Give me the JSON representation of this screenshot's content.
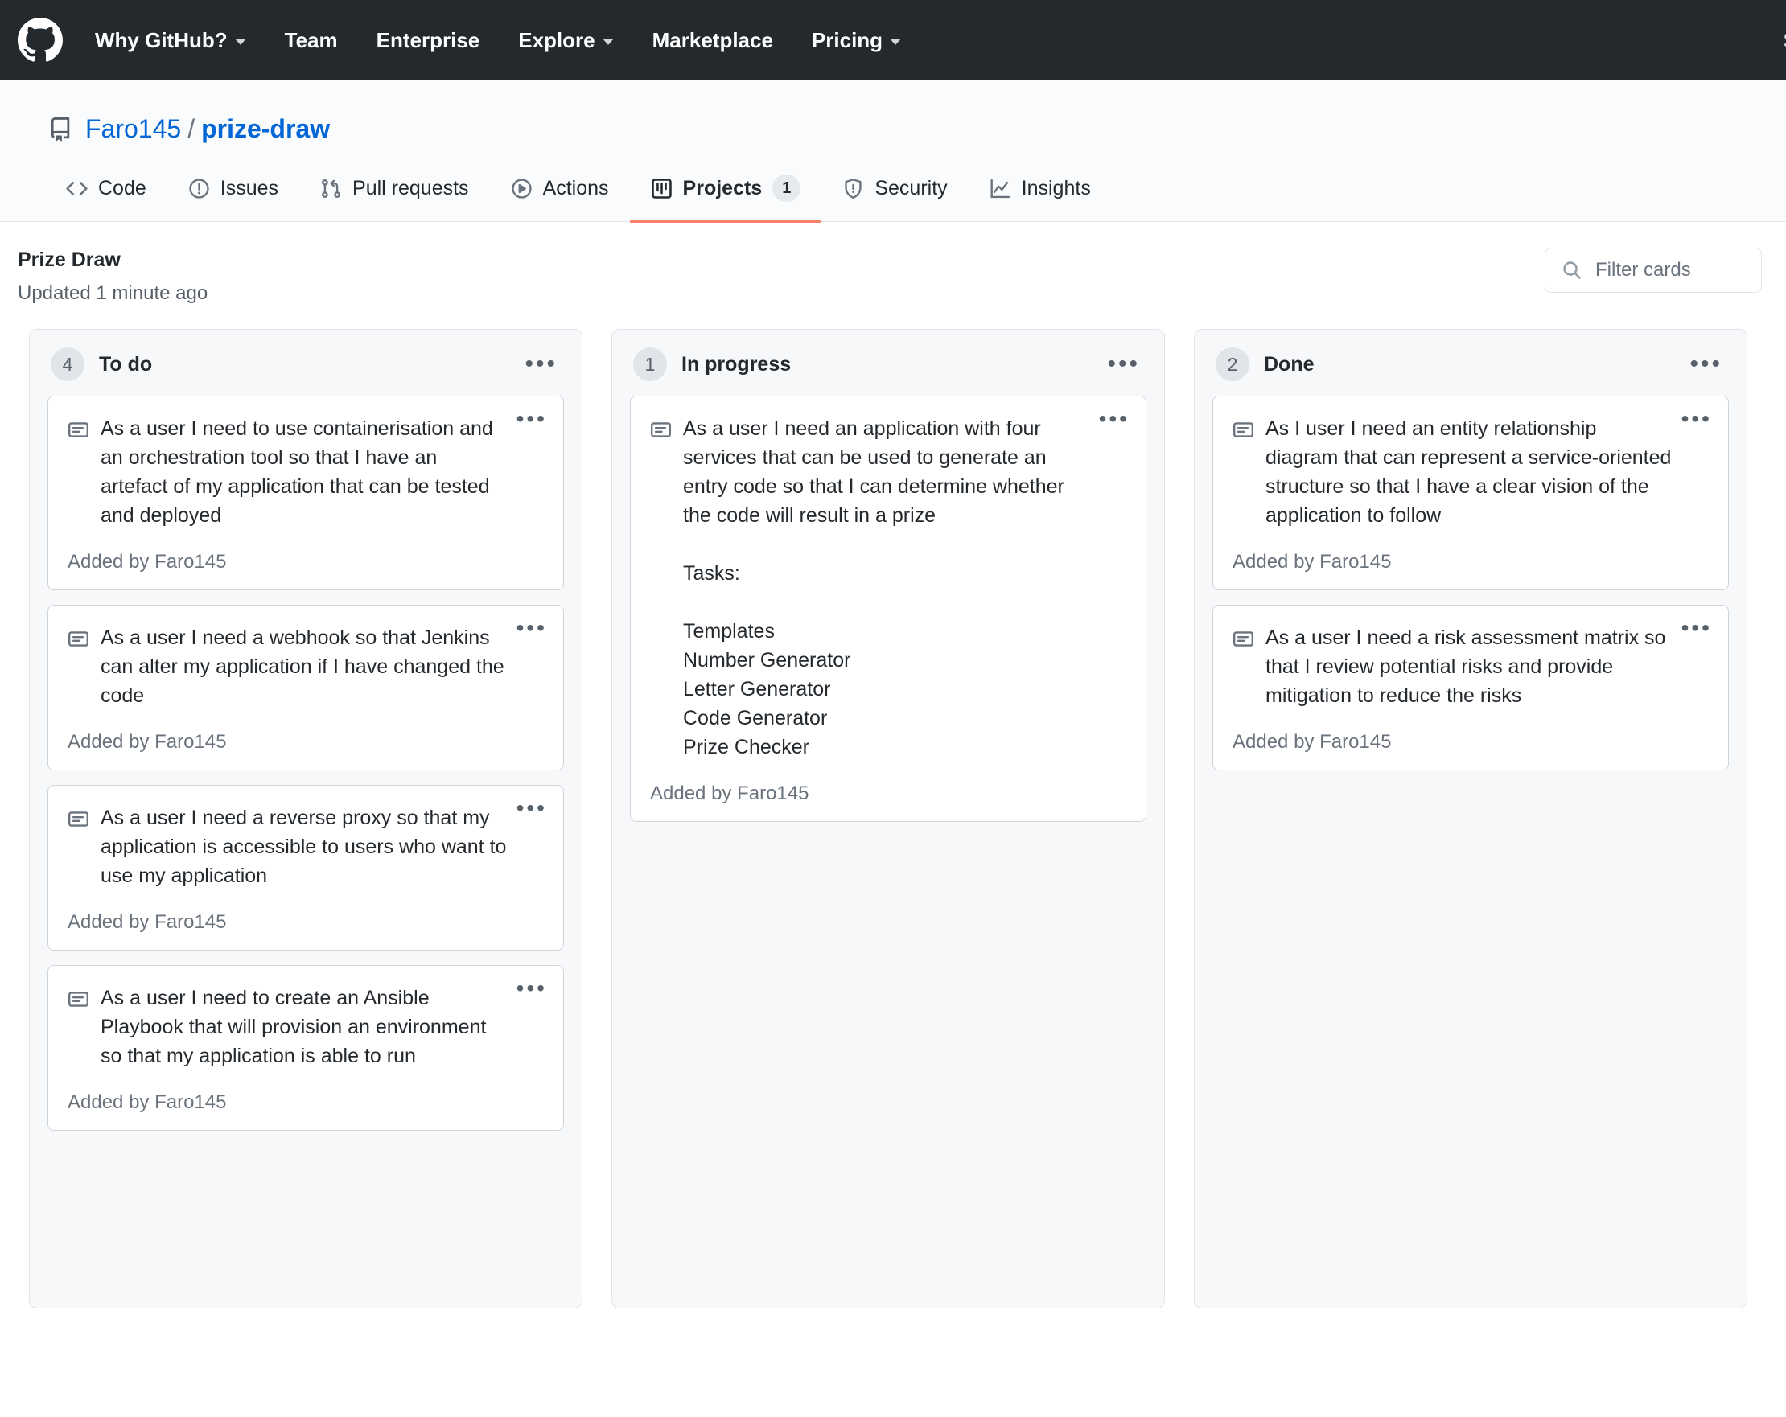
{
  "global_nav": {
    "logo_name": "github-logo",
    "items": [
      {
        "label": "Why GitHub?",
        "has_caret": true
      },
      {
        "label": "Team",
        "has_caret": false
      },
      {
        "label": "Enterprise",
        "has_caret": false
      },
      {
        "label": "Explore",
        "has_caret": true
      },
      {
        "label": "Marketplace",
        "has_caret": false
      },
      {
        "label": "Pricing",
        "has_caret": true
      }
    ],
    "right_truncated": "Se"
  },
  "repo": {
    "owner": "Faro145",
    "separator": "/",
    "name": "prize-draw",
    "tabs": [
      {
        "label": "Code",
        "icon": "code-icon",
        "count": null,
        "selected": false
      },
      {
        "label": "Issues",
        "icon": "issue-opened-icon",
        "count": null,
        "selected": false
      },
      {
        "label": "Pull requests",
        "icon": "git-pull-request-icon",
        "count": null,
        "selected": false
      },
      {
        "label": "Actions",
        "icon": "play-icon",
        "count": null,
        "selected": false
      },
      {
        "label": "Projects",
        "icon": "project-board-icon",
        "count": "1",
        "selected": true
      },
      {
        "label": "Security",
        "icon": "shield-icon",
        "count": null,
        "selected": false
      },
      {
        "label": "Insights",
        "icon": "graph-icon",
        "count": null,
        "selected": false
      }
    ]
  },
  "project": {
    "name": "Prize Draw",
    "updated": "Updated 1 minute ago",
    "filter_placeholder": "Filter cards",
    "filter_value": ""
  },
  "colors": {
    "nav_background": "#24292e",
    "link_blue": "#0366d6",
    "active_tab_underline": "#f9826c",
    "column_background": "#f6f8fa",
    "border": "#e1e4e8"
  },
  "board": {
    "columns": [
      {
        "count": "4",
        "title": "To do",
        "menu": "•••",
        "cards": [
          {
            "text": "As a user I need to use containerisation and an orchestration tool so that I have an artefact of my application that can be tested and deployed",
            "added_by": "Added by Faro145"
          },
          {
            "text": "As a user I need a webhook so that Jenkins can alter my application if I have changed the code",
            "added_by": "Added by Faro145"
          },
          {
            "text": "As a user I need a reverse proxy so that my application is accessible to users who want to use my application",
            "added_by": "Added by Faro145"
          },
          {
            "text": "As a user I need to create an Ansible Playbook that will provision an environment so that my application is able to run",
            "added_by": "Added by Faro145"
          }
        ]
      },
      {
        "count": "1",
        "title": "In progress",
        "menu": "•••",
        "cards": [
          {
            "text": "As a user I need an application with four services that can be used to generate an entry code so that I can determine whether the code will result in a prize\n\nTasks:\n\nTemplates\nNumber Generator\nLetter Generator\nCode Generator\nPrize Checker",
            "added_by": "Added by Faro145"
          }
        ]
      },
      {
        "count": "2",
        "title": "Done",
        "menu": "•••",
        "cards": [
          {
            "text": "As I user I need an entity relationship diagram that can represent a service-oriented structure so that I have a clear vision of the application to follow",
            "added_by": "Added by Faro145"
          },
          {
            "text": "As a user I need a risk assessment matrix so that I review potential risks and provide mitigation to reduce the risks",
            "added_by": "Added by Faro145"
          }
        ]
      }
    ]
  }
}
